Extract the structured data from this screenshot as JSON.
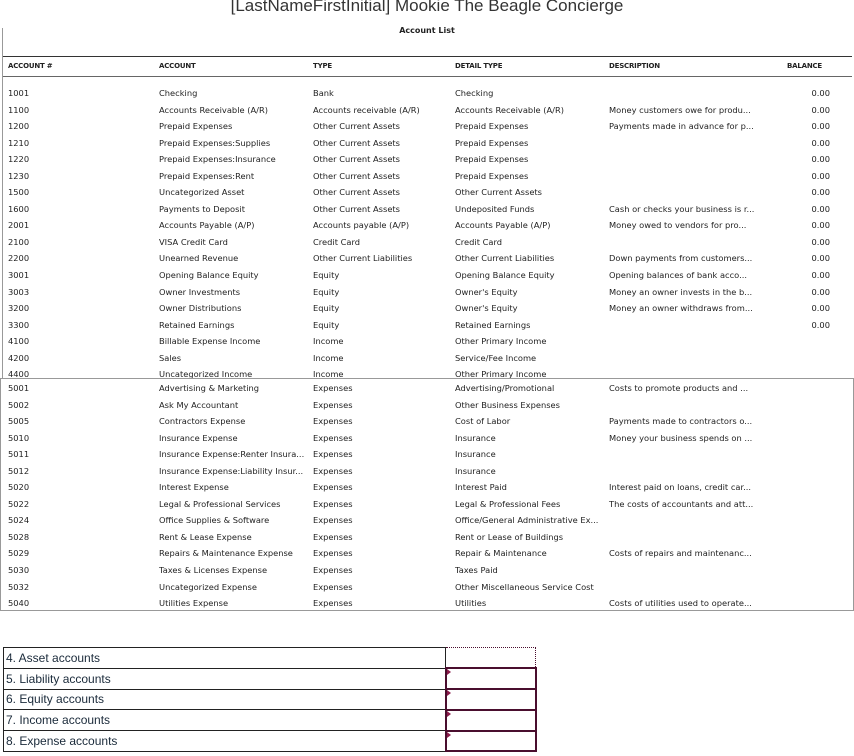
{
  "report": {
    "title": "[LastNameFirstInitial] Mookie The Beagle Concierge",
    "subtitle": "Account List"
  },
  "columns": [
    "ACCOUNT #",
    "ACCOUNT",
    "TYPE",
    "DETAIL TYPE",
    "DESCRIPTION",
    "BALANCE"
  ],
  "rows_top": [
    [
      "1001",
      "Checking",
      "Bank",
      "Checking",
      "",
      "0.00"
    ],
    [
      "1100",
      "Accounts Receivable (A/R)",
      "Accounts receivable (A/R)",
      "Accounts Receivable (A/R)",
      "Money customers owe for produ...",
      "0.00"
    ],
    [
      "1200",
      "Prepaid Expenses",
      "Other Current Assets",
      "Prepaid Expenses",
      "Payments made in advance for p...",
      "0.00"
    ],
    [
      "1210",
      "Prepaid Expenses:Supplies",
      "Other Current Assets",
      "Prepaid Expenses",
      "",
      "0.00"
    ],
    [
      "1220",
      "Prepaid Expenses:Insurance",
      "Other Current Assets",
      "Prepaid Expenses",
      "",
      "0.00"
    ],
    [
      "1230",
      "Prepaid Expenses:Rent",
      "Other Current Assets",
      "Prepaid Expenses",
      "",
      "0.00"
    ],
    [
      "1500",
      "Uncategorized Asset",
      "Other Current Assets",
      "Other Current Assets",
      "",
      "0.00"
    ],
    [
      "1600",
      "Payments to Deposit",
      "Other Current Assets",
      "Undeposited Funds",
      "Cash or checks your business is r...",
      "0.00"
    ],
    [
      "2001",
      "Accounts Payable (A/P)",
      "Accounts payable (A/P)",
      "Accounts Payable (A/P)",
      "Money owed to vendors for pro...",
      "0.00"
    ],
    [
      "2100",
      "VISA Credit Card",
      "Credit Card",
      "Credit Card",
      "",
      "0.00"
    ],
    [
      "2200",
      "Unearned Revenue",
      "Other Current Liabilities",
      "Other Current Liabilities",
      "Down payments from customers...",
      "0.00"
    ],
    [
      "3001",
      "Opening Balance Equity",
      "Equity",
      "Opening Balance Equity",
      "Opening balances of bank acco...",
      "0.00"
    ],
    [
      "3003",
      "Owner Investments",
      "Equity",
      "Owner's Equity",
      "Money an owner invests in the b...",
      "0.00"
    ],
    [
      "3200",
      "Owner Distributions",
      "Equity",
      "Owner's Equity",
      "Money an owner withdraws from...",
      "0.00"
    ],
    [
      "3300",
      "Retained Earnings",
      "Equity",
      "Retained Earnings",
      "",
      "0.00"
    ],
    [
      "4100",
      "Billable Expense Income",
      "Income",
      "Other Primary Income",
      "",
      ""
    ],
    [
      "4200",
      "Sales",
      "Income",
      "Service/Fee Income",
      "",
      ""
    ],
    [
      "4400",
      "Uncategorized Income",
      "Income",
      "Other Primary Income",
      "",
      ""
    ]
  ],
  "rows_bottom": [
    [
      "5001",
      "Advertising & Marketing",
      "Expenses",
      "Advertising/Promotional",
      "Costs to promote products and ..."
    ],
    [
      "5002",
      "Ask My Accountant",
      "Expenses",
      "Other Business Expenses",
      ""
    ],
    [
      "5005",
      "Contractors Expense",
      "Expenses",
      "Cost of Labor",
      "Payments made to contractors o..."
    ],
    [
      "5010",
      "Insurance Expense",
      "Expenses",
      "Insurance",
      "Money your business spends on ..."
    ],
    [
      "5011",
      "Insurance Expense:Renter Insura...",
      "Expenses",
      "Insurance",
      ""
    ],
    [
      "5012",
      "Insurance Expense:Liability Insur...",
      "Expenses",
      "Insurance",
      ""
    ],
    [
      "5020",
      "Interest Expense",
      "Expenses",
      "Interest Paid",
      "Interest paid on loans, credit car..."
    ],
    [
      "5022",
      "Legal & Professional Services",
      "Expenses",
      "Legal & Professional Fees",
      "The costs of accountants and att..."
    ],
    [
      "5024",
      "Office Supplies & Software",
      "Expenses",
      "Office/General Administrative Ex...",
      ""
    ],
    [
      "5028",
      "Rent & Lease Expense",
      "Expenses",
      "Rent or Lease of Buildings",
      ""
    ],
    [
      "5029",
      "Repairs & Maintenance Expense",
      "Expenses",
      "Repair & Maintenance",
      "Costs of repairs and maintenanc..."
    ],
    [
      "5030",
      "Taxes & Licenses Expense",
      "Expenses",
      "Taxes Paid",
      ""
    ],
    [
      "5032",
      "Uncategorized Expense",
      "Expenses",
      "Other Miscellaneous Service Cost",
      ""
    ],
    [
      "5040",
      "Utilities Expense",
      "Expenses",
      "Utilities",
      "Costs of utilities used to operate..."
    ]
  ],
  "questions": [
    {
      "label": "4. Asset accounts",
      "answer": ""
    },
    {
      "label": "5. Liability accounts",
      "answer": ""
    },
    {
      "label": "6. Equity accounts",
      "answer": ""
    },
    {
      "label": "7. Income accounts",
      "answer": ""
    },
    {
      "label": "8. Expense accounts",
      "answer": ""
    }
  ],
  "colors": {
    "answer_border": "#4a0e2e"
  }
}
